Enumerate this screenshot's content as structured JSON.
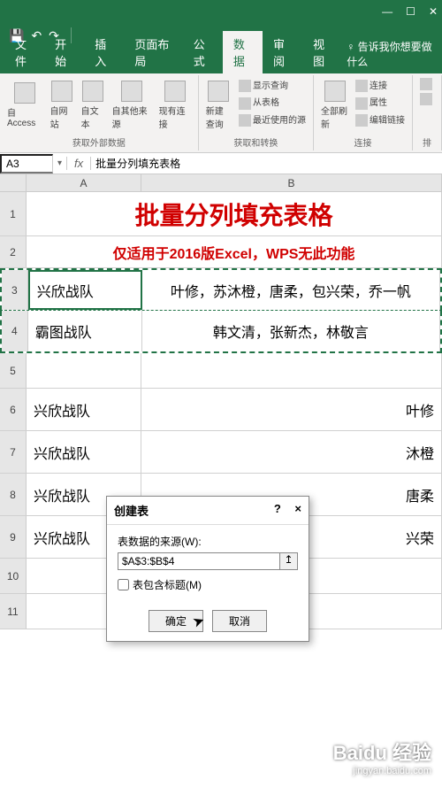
{
  "qat": {
    "save": "💾",
    "undo": "↶",
    "redo": "↷"
  },
  "tabs": {
    "file": "文件",
    "home": "开始",
    "insert": "插入",
    "layout": "页面布局",
    "formulas": "公式",
    "data": "数据",
    "review": "审阅",
    "view": "视图",
    "tellme": "告诉我你想要做什么"
  },
  "ribbon": {
    "external": {
      "access": "自 Access",
      "web": "自网站",
      "text": "自文本",
      "other": "自其他来源",
      "existing": "现有连接",
      "group_label": "获取外部数据"
    },
    "query": {
      "new": "新建查询",
      "show": "显示查询",
      "table": "从表格",
      "recent": "最近使用的源",
      "group_label": "获取和转换"
    },
    "refresh": {
      "all": "全部刷新",
      "conn": "连接",
      "prop": "属性",
      "edit": "编辑链接",
      "group_label": "连接"
    },
    "sort_group": "排"
  },
  "name_box": "A3",
  "formula_bar": "批量分列填充表格",
  "col_headers": {
    "a": "A",
    "b": "B"
  },
  "row_headers": [
    "1",
    "2",
    "3",
    "4",
    "5",
    "6",
    "7",
    "8",
    "9",
    "10",
    "11"
  ],
  "cells": {
    "title": "批量分列填充表格",
    "subtitle": "仅适用于2016版Excel，WPS无此功能",
    "r3a": "兴欣战队",
    "r3b": "叶修，苏沐橙，唐柔，包兴荣，乔一帆",
    "r4a": "霸图战队",
    "r4b": "韩文清，张新杰，林敬言",
    "r6a": "兴欣战队",
    "r6b_tail": "叶修",
    "r7a": "兴欣战队",
    "r7b_tail": "沐橙",
    "r8a": "兴欣战队",
    "r8b_tail": "唐柔",
    "r9a": "兴欣战队",
    "r9b_tail": "兴荣"
  },
  "dialog": {
    "title": "创建表",
    "help": "?",
    "close": "×",
    "source_label": "表数据的来源(W):",
    "source_value": "$A$3:$B$4",
    "range_icon": "↥",
    "checkbox_label": "表包含标题(M)",
    "ok": "确定",
    "cancel": "取消"
  },
  "watermark": {
    "logo": "Baidu 经验",
    "url": "jingyan.baidu.com"
  }
}
